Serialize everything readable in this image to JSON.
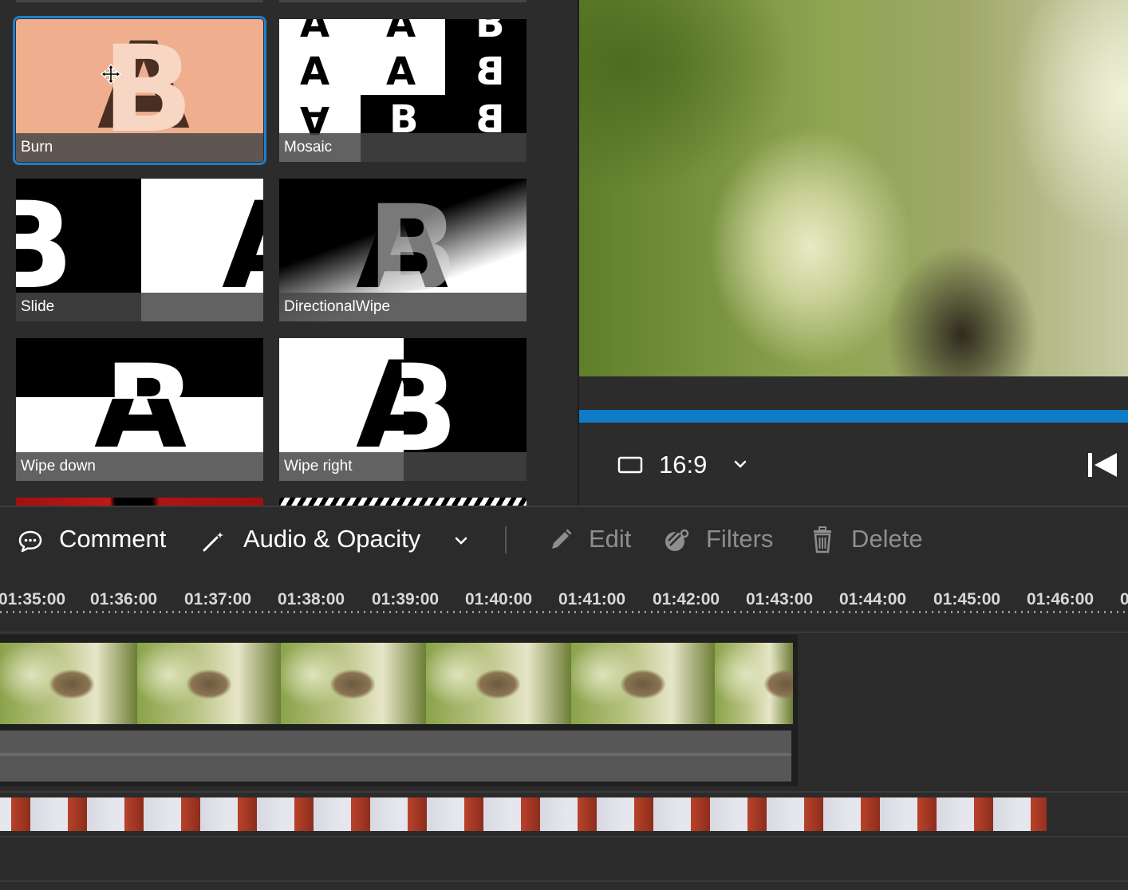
{
  "transitions": {
    "items": [
      {
        "label": "Burn",
        "selected": true
      },
      {
        "label": "Mosaic",
        "selected": false
      },
      {
        "label": "Slide",
        "selected": false
      },
      {
        "label": "DirectionalWipe",
        "selected": false
      },
      {
        "label": "Wipe down",
        "selected": false
      },
      {
        "label": "Wipe right",
        "selected": false
      }
    ]
  },
  "preview": {
    "aspect_ratio": "16:9",
    "progress_fraction": 1.0,
    "icons": {
      "aspect": "rectangle-icon",
      "dropdown": "chevron-down-icon",
      "skip": "skip-to-start-icon"
    }
  },
  "toolbar": {
    "comment_label": "Comment",
    "audio_opacity_label": "Audio & Opacity",
    "edit_label": "Edit",
    "filters_label": "Filters",
    "delete_label": "Delete"
  },
  "timeline": {
    "ticks": [
      "01:35:00",
      "01:36:00",
      "01:37:00",
      "01:38:00",
      "01:39:00",
      "01:40:00",
      "01:41:00",
      "01:42:00",
      "01:43:00",
      "01:44:00",
      "01:45:00",
      "01:46:00"
    ]
  },
  "colors": {
    "accent": "#1f7fce",
    "progress": "#0f7bc6",
    "burn_bg": "#efae8d"
  }
}
